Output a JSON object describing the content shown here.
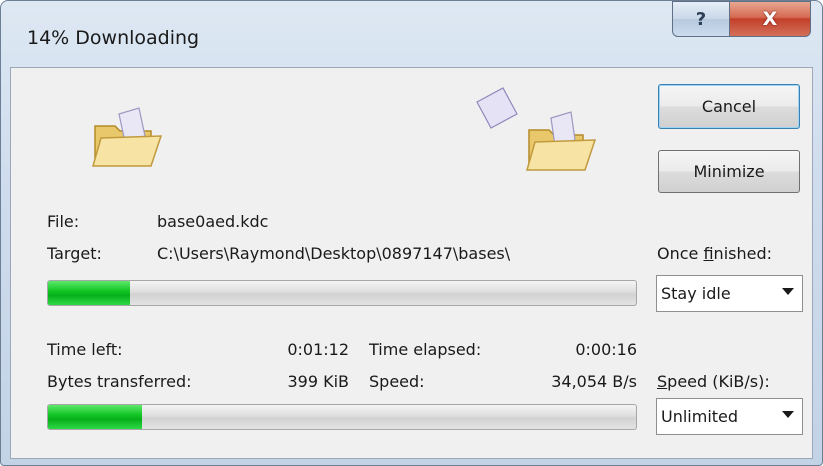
{
  "window": {
    "title": "14% Downloading",
    "help_glyph": "?",
    "close_glyph": "X"
  },
  "file_label": "File:",
  "file_value": "base0aed.kdc",
  "target_label": "Target:",
  "target_value": "C:\\Users\\Raymond\\Desktop\\0897147\\bases\\",
  "file_progress": {
    "percent": 14
  },
  "overall_progress": {
    "percent": 16
  },
  "stats": {
    "time_left_label": "Time left:",
    "time_left_value": "0:01:12",
    "time_elapsed_label": "Time elapsed:",
    "time_elapsed_value": "0:00:16",
    "bytes_label": "Bytes transferred:",
    "bytes_value": "399 KiB",
    "speed_label": "Speed:",
    "speed_value": "34,054 B/s"
  },
  "buttons": {
    "cancel": "Cancel",
    "minimize": "Minimize"
  },
  "once_finished": {
    "label_pre": "Once ",
    "label_accel": "f",
    "label_post": "inished:",
    "selected": "Stay idle"
  },
  "speed_limit": {
    "label_accel": "S",
    "label_post": "peed (KiB/s):",
    "selected": "Unlimited"
  },
  "icons": {
    "source_folder": "folder-open-icon",
    "dest_folder": "folder-open-icon",
    "flying_document": "document-icon"
  },
  "colors": {
    "progress_green": "#06b01a",
    "close_red": "#c2402a",
    "default_button_border": "#3c7fb1"
  }
}
